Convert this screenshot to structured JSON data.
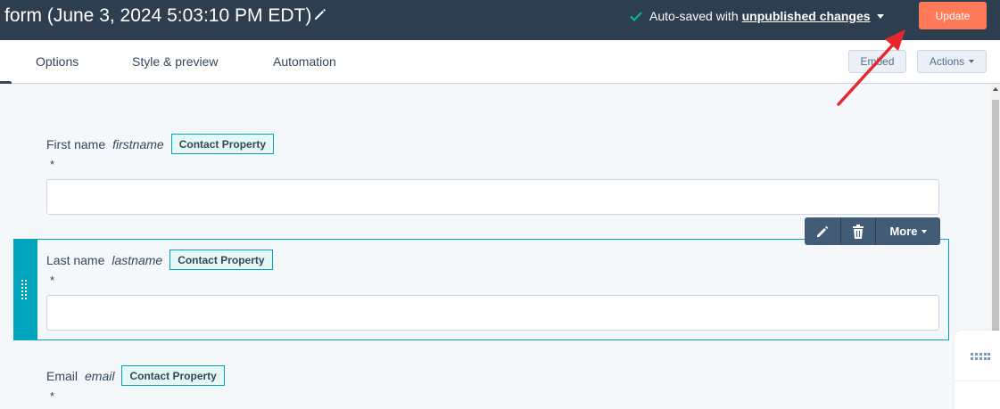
{
  "header": {
    "title": "form (June 3, 2024 5:03:10 PM EDT)",
    "autosave_text": "Auto-saved with",
    "autosave_link": "unpublished changes",
    "update_label": "Update"
  },
  "tabs": [
    {
      "label": "Options"
    },
    {
      "label": "Style & preview"
    },
    {
      "label": "Automation"
    }
  ],
  "toolbar": {
    "embed_label": "Embed",
    "actions_label": "Actions"
  },
  "fields": [
    {
      "label": "First name",
      "property": "firstname",
      "badge": "Contact Property",
      "required_mark": "*",
      "value": ""
    },
    {
      "label": "Last name",
      "property": "lastname",
      "badge": "Contact Property",
      "required_mark": "*",
      "value": ""
    },
    {
      "label": "Email",
      "property": "email",
      "badge": "Contact Property",
      "required_mark": "*",
      "value": ""
    }
  ],
  "field_toolbar": {
    "more_label": "More"
  },
  "colors": {
    "header_bg": "#2d3e50",
    "accent": "#ff7a59",
    "selection": "#00a4bd",
    "check": "#00bda5",
    "annotation_arrow": "#e8262d"
  },
  "icons": [
    "edit-icon",
    "check-icon",
    "caret-down-icon",
    "pencil-icon",
    "trash-icon",
    "drag-handle-icon",
    "grid-icon"
  ]
}
